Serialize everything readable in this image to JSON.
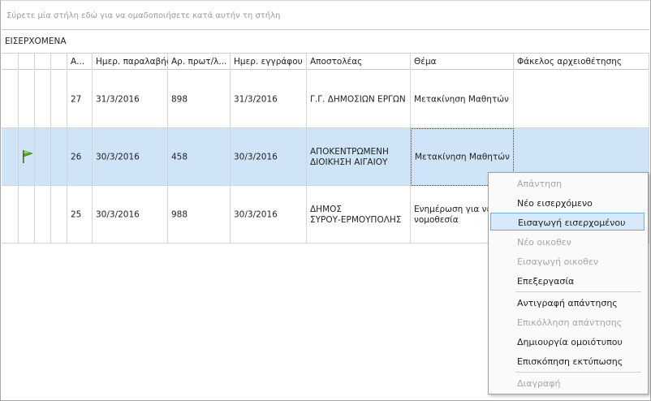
{
  "group_panel": {
    "hint": "Σύρετε μία στήλη εδώ για να ομαδοποιήσετε κατά αυτήν τη στήλη"
  },
  "group": {
    "title": "ΕΙΣΕΡΧΟΜΕΝΑ"
  },
  "columns": {
    "a": "Α...",
    "received_date": "Ημερ. παραλαβής",
    "protocol_no": "Αρ. πρωτ/λ...",
    "doc_date": "Ημερ. εγγράφου",
    "sender": "Αποστολέας",
    "subject": "Θέμα",
    "folder": "Φάκελος αρχειοθέτησης"
  },
  "rows": [
    {
      "a": "27",
      "received_date": "31/3/2016",
      "protocol_no": "898",
      "doc_date": "31/3/2016",
      "sender": "Γ.Γ. ΔΗΜΟΣΙΩΝ ΕΡΓΩΝ",
      "subject": "Μετακίνηση Μαθητών",
      "folder": "",
      "flag": false
    },
    {
      "a": "26",
      "received_date": "30/3/2016",
      "protocol_no": "458",
      "doc_date": "30/3/2016",
      "sender": "ΑΠΟΚΕΝΤΡΩΜΕΝΗ\nΔΙΟΙΚΗΣΗ ΑΙΓΑΙΟΥ",
      "subject": "Μετακίνηση Μαθητών",
      "folder": "",
      "flag": true
    },
    {
      "a": "25",
      "received_date": "30/3/2016",
      "protocol_no": "988",
      "doc_date": "30/3/2016",
      "sender": "ΔΗΜΟΣ\nΣΥΡΟΥ-ΕΡΜΟΥΠΟΛΗΣ",
      "subject": "Ενημέρωση για νέα\nνομοθεσία",
      "folder": "",
      "flag": false
    }
  ],
  "context_menu": {
    "items": [
      {
        "label": "Απάντηση",
        "enabled": false
      },
      {
        "label": "Νέο εισερχόμενο",
        "enabled": true
      },
      {
        "label": "Εισαγωγή εισερχομένου",
        "enabled": true,
        "highlighted": true
      },
      {
        "label": "Νέο οικοθεν",
        "enabled": false
      },
      {
        "label": "Εισαγωγή οικοθεν",
        "enabled": false
      },
      {
        "label": "Επεξεργασία",
        "enabled": true
      },
      {
        "label": "Αντιγραφή απάντησης",
        "enabled": true
      },
      {
        "label": "Επικόλληση απάντησης",
        "enabled": false
      },
      {
        "label": "Δημιουργία ομοιότυπου",
        "enabled": true
      },
      {
        "label": "Επισκόπηση εκτύπωσης",
        "enabled": true
      },
      {
        "label": "Διαγραφή",
        "enabled": false
      }
    ]
  },
  "icons": {
    "flag": "green-flag-icon"
  },
  "colors": {
    "selected_row": "#cfe4f6",
    "menu_highlight": "#d7e8f8",
    "flag": "#5aa02c"
  }
}
